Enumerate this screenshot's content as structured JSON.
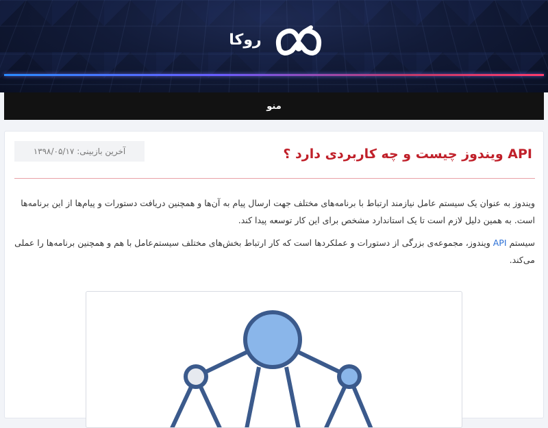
{
  "brand": {
    "name": "روکا",
    "logo_icon": "roka-logo-icon"
  },
  "menu": {
    "label": "منو"
  },
  "article": {
    "title": "API ویندوز چیست و چه کاربردی دارد ؟",
    "last_modified": "آخرین بازبینی: ۱۳۹۸/۰۵/۱۷",
    "paragraph1": "ویندوز به عنوان یک سیستم عامل نیازمند ارتباط با برنامه‌های مختلف جهت ارسال پیام به آن‌ها و همچنین دریافت دستورات و پیام‌ها از این برنامه‌ها است. به همین دلیل لازم است تا یک استاندارد مشخص برای این کار توسعه پیدا کند.",
    "paragraph2_before": "سیستم ",
    "paragraph2_link": "API",
    "paragraph2_after": " ویندوز، مجموعه‌ی بزرگی از دستورات و عملکردها است که کار ارتباط بخش‌های مختلف سیستم‌عامل با هم و همچنین برنامه‌ها را عملی می‌کند.",
    "figure_icon": "network-diagram-icon"
  },
  "colors": {
    "title_red": "#c0202a",
    "link_blue": "#2a6fd6",
    "node_fill": "#8ab6ea",
    "node_stroke": "#3b5a8c"
  }
}
